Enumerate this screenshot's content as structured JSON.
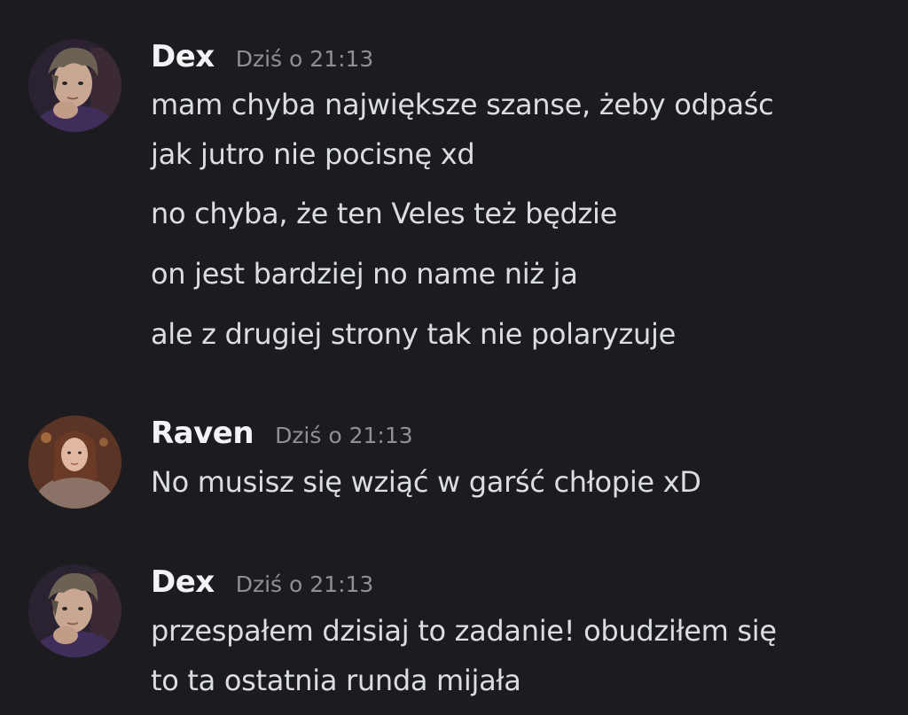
{
  "colors": {
    "background": "#1c1c20",
    "username": "#f2f3f5",
    "timestamp": "#8e9097",
    "message_text": "#dbdee1"
  },
  "messages": [
    {
      "author": "Dex",
      "timestamp": "Dziś o 21:13",
      "avatar_icon": "dex-avatar",
      "lines": [
        "mam chyba największe szanse, żeby odpaśc",
        "jak jutro nie pocisnę xd",
        "no chyba, że ten Veles też będzie",
        "on jest bardziej no name niż ja",
        "ale z drugiej strony tak nie polaryzuje"
      ]
    },
    {
      "author": "Raven",
      "timestamp": "Dziś o 21:13",
      "avatar_icon": "raven-avatar",
      "lines": [
        "No musisz się wziąć w garść chłopie xD"
      ]
    },
    {
      "author": "Dex",
      "timestamp": "Dziś o 21:13",
      "avatar_icon": "dex-avatar",
      "lines": [
        "przespałem dzisiaj to zadanie! obudziłem się",
        "to ta ostatnia runda mijała"
      ]
    }
  ]
}
